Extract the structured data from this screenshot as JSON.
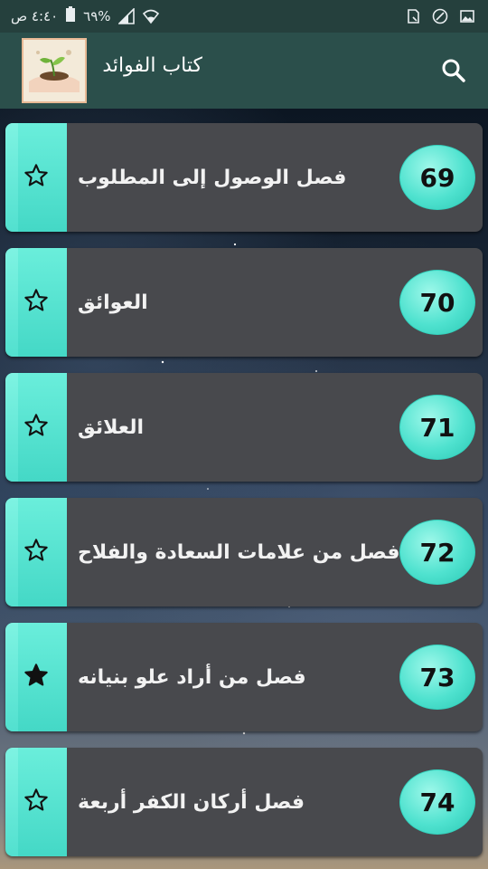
{
  "status_bar": {
    "time": "٤:٤٠ ص",
    "battery": "٦٩%",
    "icons": [
      "battery-icon",
      "signal-icon",
      "wifi-icon",
      "sim-card-icon",
      "shield-icon",
      "image-icon"
    ]
  },
  "app_bar": {
    "title": "كتاب الفوائد",
    "search_icon": "search-icon"
  },
  "items": [
    {
      "number": "69",
      "title": "فصل الوصول إلى المطلوب",
      "favorite": false
    },
    {
      "number": "70",
      "title": "العوائق",
      "favorite": false
    },
    {
      "number": "71",
      "title": "العلائق",
      "favorite": false
    },
    {
      "number": "72",
      "title": "فصل من علامات السعادة والفلاح",
      "favorite": false
    },
    {
      "number": "73",
      "title": "فصل من أراد علو بنيانه",
      "favorite": true
    },
    {
      "number": "74",
      "title": "فصل أركان الكفر أربعة",
      "favorite": false
    }
  ],
  "colors": {
    "accent": "#52e0cf",
    "card": "#48494d",
    "app_bar": "#2b4f4b",
    "status_bar": "#25403d"
  }
}
